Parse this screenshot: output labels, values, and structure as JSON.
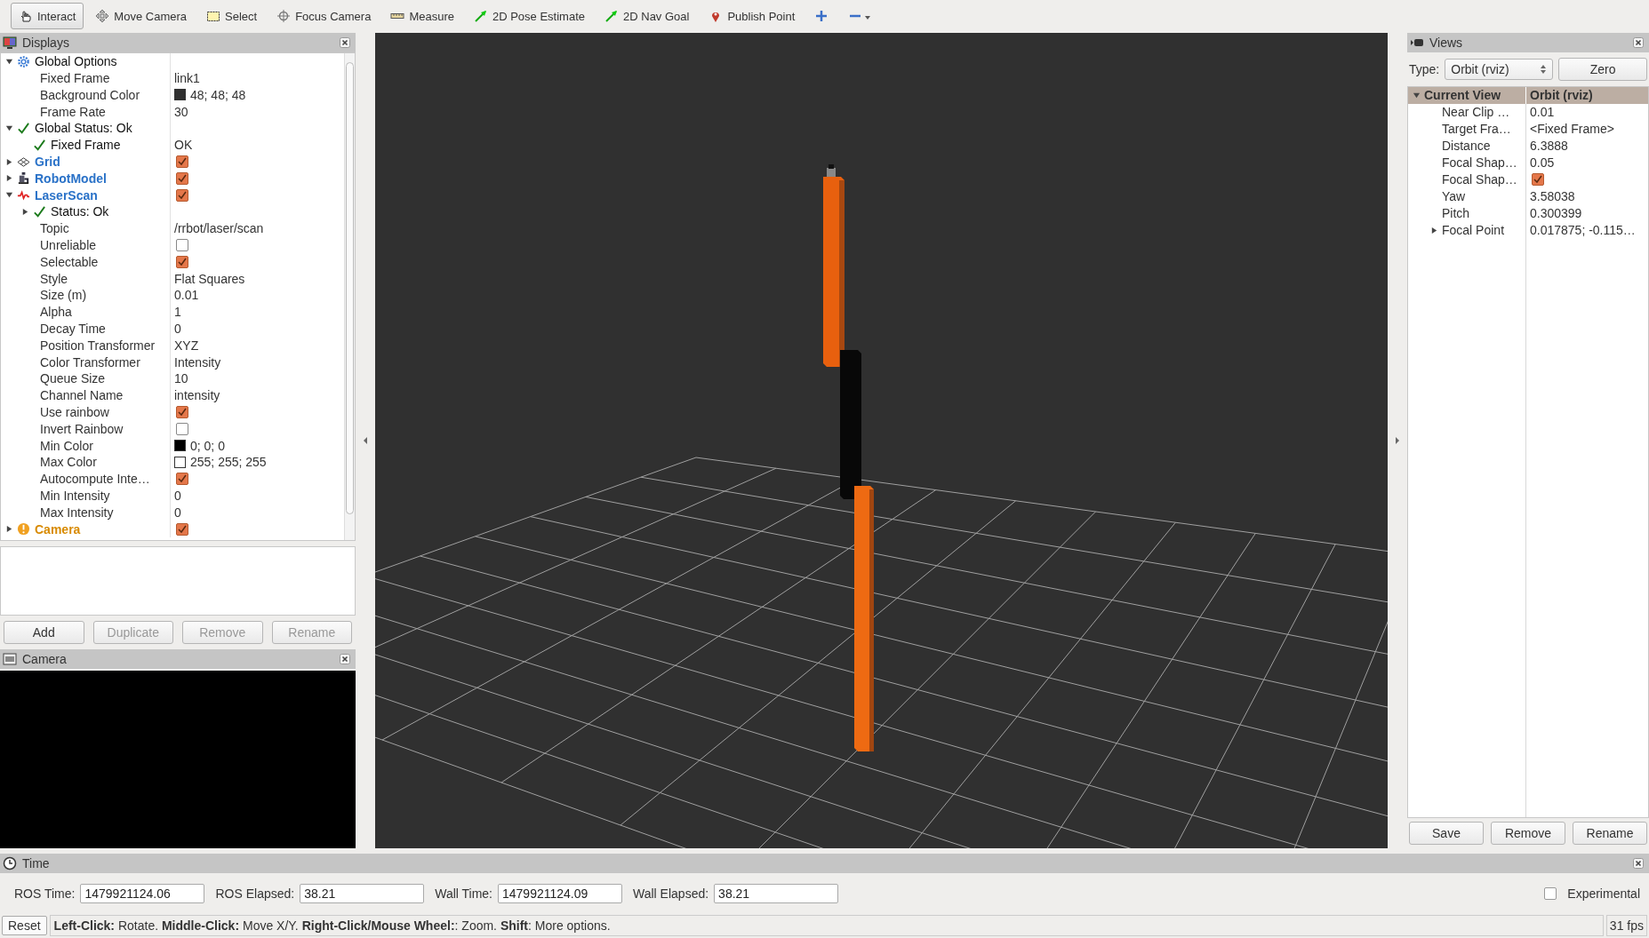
{
  "toolbar": {
    "tools": [
      {
        "label": "Interact",
        "selected": true
      },
      {
        "label": "Move Camera",
        "selected": false
      },
      {
        "label": "Select",
        "selected": false
      },
      {
        "label": "Focus Camera",
        "selected": false
      },
      {
        "label": "Measure",
        "selected": false
      },
      {
        "label": "2D Pose Estimate",
        "selected": false
      },
      {
        "label": "2D Nav Goal",
        "selected": false
      },
      {
        "label": "Publish Point",
        "selected": false
      }
    ]
  },
  "displays": {
    "title": "Displays",
    "tree": [
      {
        "label": "Global Options",
        "kind": "group",
        "expanded": true,
        "children": [
          {
            "label": "Fixed Frame",
            "kind": "property",
            "value": "link1"
          },
          {
            "label": "Background Color",
            "kind": "property",
            "value": "48; 48; 48",
            "color": "#303030"
          },
          {
            "label": "Frame Rate",
            "kind": "property",
            "value": "30"
          }
        ]
      },
      {
        "label": "Global Status: Ok",
        "kind": "status",
        "expanded": true,
        "children": [
          {
            "label": "Fixed Frame",
            "kind": "status",
            "value": "OK"
          }
        ]
      },
      {
        "label": "Grid",
        "kind": "display",
        "warning": false,
        "checked": true,
        "expanded": false
      },
      {
        "label": "RobotModel",
        "kind": "display",
        "warning": false,
        "checked": true,
        "expanded": false
      },
      {
        "label": "LaserScan",
        "kind": "display",
        "warning": false,
        "checked": true,
        "expanded": true,
        "children": [
          {
            "label": "Status: Ok",
            "kind": "status",
            "expanded": false
          },
          {
            "label": "Topic",
            "kind": "property",
            "value": "/rrbot/laser/scan"
          },
          {
            "label": "Unreliable",
            "kind": "property",
            "checked": false
          },
          {
            "label": "Selectable",
            "kind": "property",
            "checked": true
          },
          {
            "label": "Style",
            "kind": "property",
            "value": "Flat Squares"
          },
          {
            "label": "Size (m)",
            "kind": "property",
            "value": "0.01"
          },
          {
            "label": "Alpha",
            "kind": "property",
            "value": "1"
          },
          {
            "label": "Decay Time",
            "kind": "property",
            "value": "0"
          },
          {
            "label": "Position Transformer",
            "kind": "property",
            "value": "XYZ"
          },
          {
            "label": "Color Transformer",
            "kind": "property",
            "value": "Intensity"
          },
          {
            "label": "Queue Size",
            "kind": "property",
            "value": "10"
          },
          {
            "label": "Channel Name",
            "kind": "property",
            "value": "intensity"
          },
          {
            "label": "Use rainbow",
            "kind": "property",
            "checked": true
          },
          {
            "label": "Invert Rainbow",
            "kind": "property",
            "checked": false
          },
          {
            "label": "Min Color",
            "kind": "property",
            "value": "0; 0; 0",
            "color": "#000000"
          },
          {
            "label": "Max Color",
            "kind": "property",
            "value": "255; 255; 255",
            "color": "#ffffff"
          },
          {
            "label": "Autocompute Inte…",
            "kind": "property",
            "checked": true
          },
          {
            "label": "Min Intensity",
            "kind": "property",
            "value": "0"
          },
          {
            "label": "Max Intensity",
            "kind": "property",
            "value": "0"
          }
        ]
      },
      {
        "label": "Camera",
        "kind": "display",
        "warning": true,
        "checked": true,
        "expanded": false
      }
    ],
    "buttons": [
      {
        "label": "Add",
        "disabled": false
      },
      {
        "label": "Duplicate",
        "disabled": true
      },
      {
        "label": "Remove",
        "disabled": true
      },
      {
        "label": "Rename",
        "disabled": true
      }
    ]
  },
  "camera_panel": {
    "title": "Camera"
  },
  "views": {
    "title": "Views",
    "type_label": "Type:",
    "type_value": "Orbit (rviz)",
    "zero_button": "Zero",
    "tree": [
      {
        "label": "Current View",
        "value": "Orbit (rviz)",
        "expanded": true,
        "children": [
          {
            "label": "Near Clip …",
            "value": "0.01"
          },
          {
            "label": "Target Fra…",
            "value": "<Fixed Frame>"
          },
          {
            "label": "Distance",
            "value": "6.3888"
          },
          {
            "label": "Focal Shap…",
            "value": "0.05"
          },
          {
            "label": "Focal Shap…",
            "checked": true
          },
          {
            "label": "Yaw",
            "value": "3.58038"
          },
          {
            "label": "Pitch",
            "value": "0.300399"
          },
          {
            "label": "Focal Point",
            "value": "0.017875; -0.115…",
            "expanded": false
          }
        ]
      }
    ],
    "buttons": [
      "Save",
      "Remove",
      "Rename"
    ]
  },
  "time": {
    "title": "Time",
    "fields": [
      {
        "label": "ROS Time:",
        "value": "1479921124.06"
      },
      {
        "label": "ROS Elapsed:",
        "value": "38.21"
      },
      {
        "label": "Wall Time:",
        "value": "1479921124.09"
      },
      {
        "label": "Wall Elapsed:",
        "value": "38.21"
      }
    ],
    "experimental": {
      "label": "Experimental",
      "checked": false
    }
  },
  "status_bar": {
    "reset": "Reset",
    "help": "**Left-Click:** Rotate. **Middle-Click:** Move X/Y. **Right-Click/Mouse Wheel:**: Zoom. **Shift**: More options.",
    "fps": "31 fps"
  }
}
